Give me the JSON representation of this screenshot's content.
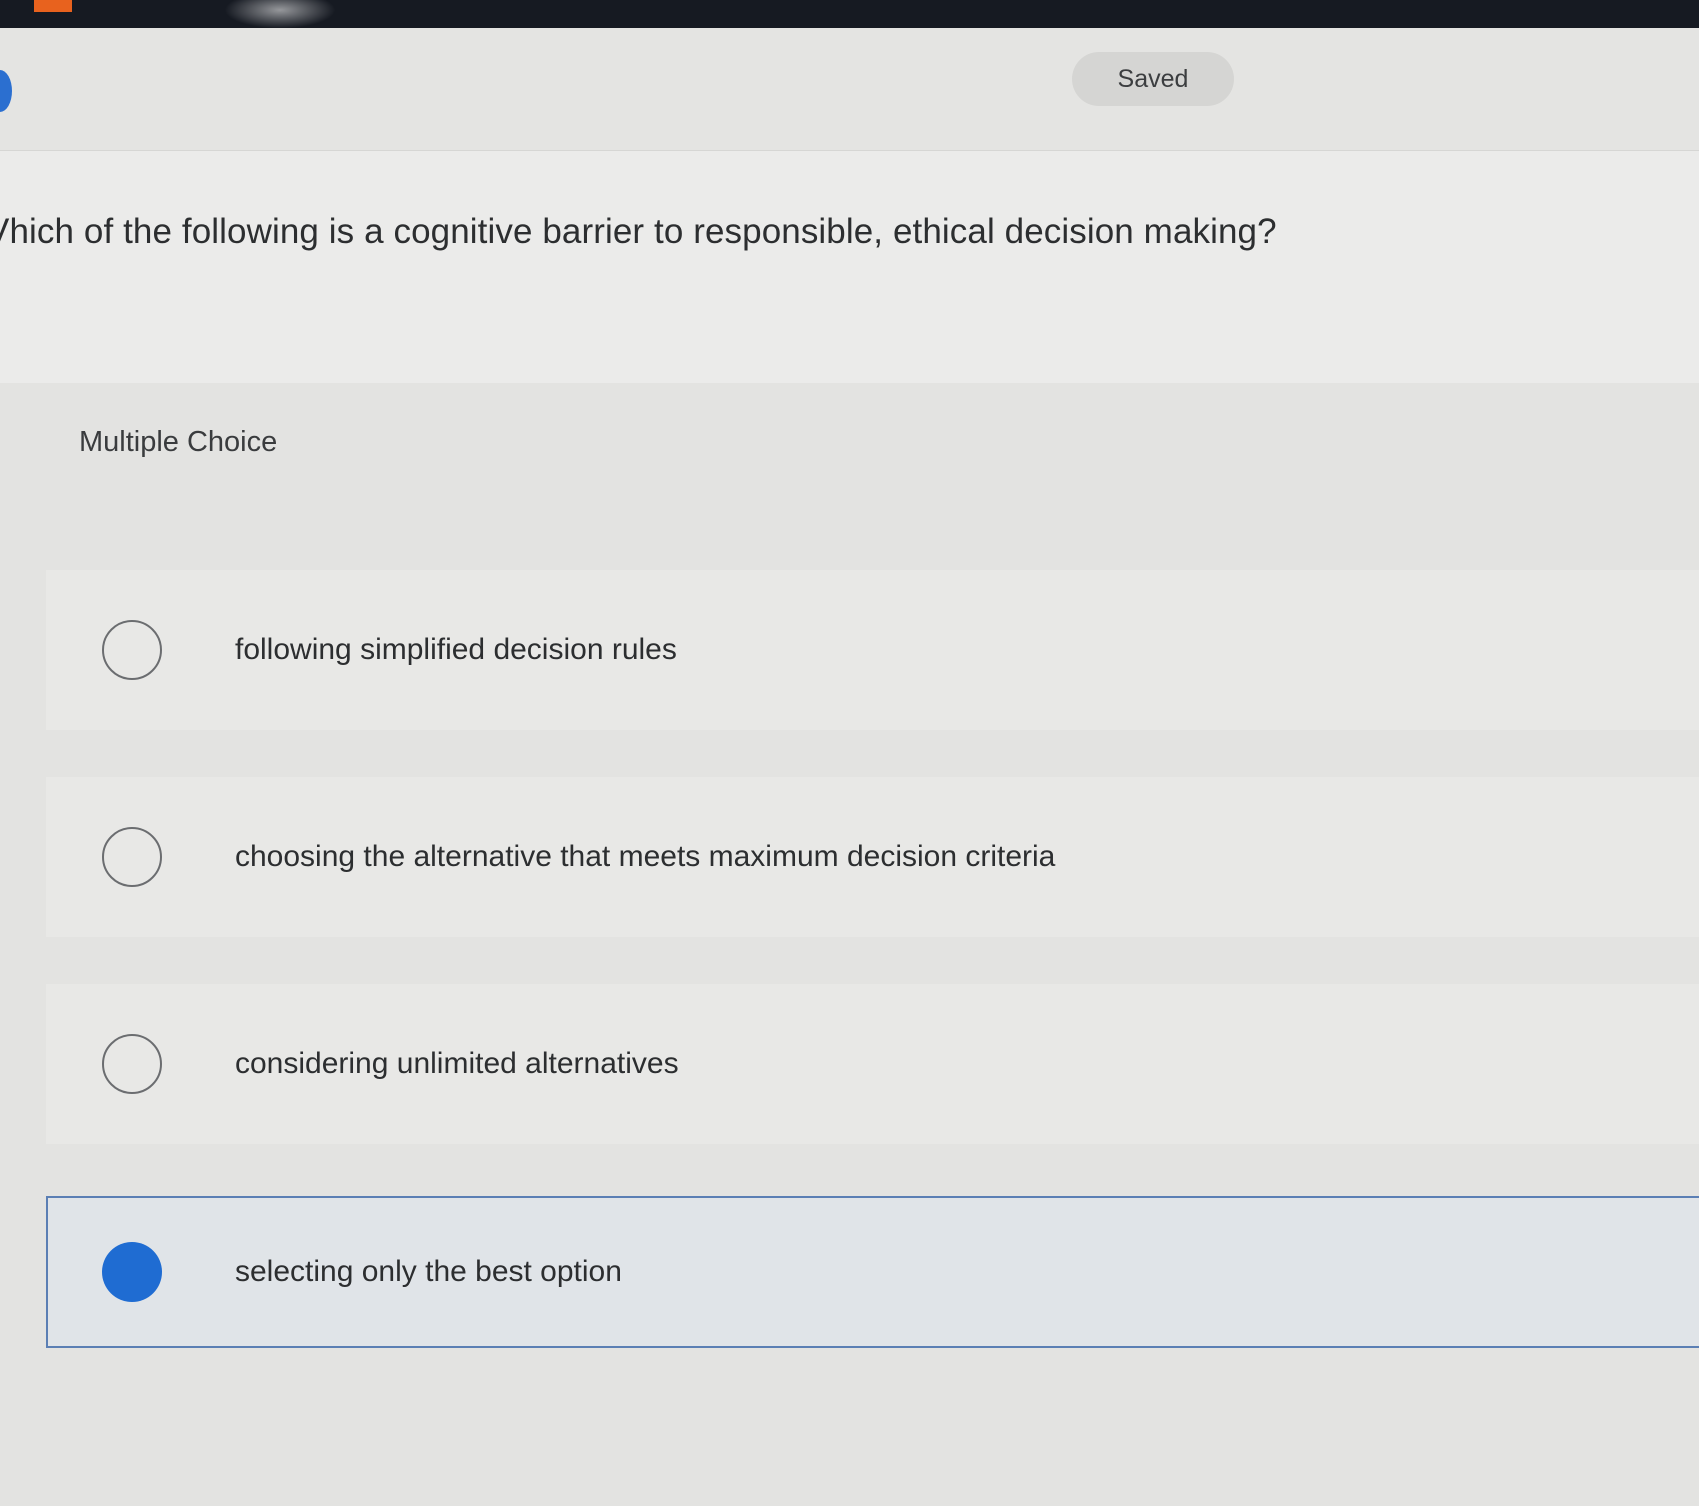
{
  "header": {
    "status_label": "Saved"
  },
  "question": {
    "text": "Vhich of the following is a cognitive barrier to responsible, ethical decision making?",
    "type_label": "Multiple Choice"
  },
  "options": [
    {
      "label": "following simplified decision rules",
      "selected": false
    },
    {
      "label": "choosing the alternative that meets maximum decision criteria",
      "selected": false
    },
    {
      "label": "considering unlimited alternatives",
      "selected": false
    },
    {
      "label": "selecting only the best option",
      "selected": true
    }
  ],
  "colors": {
    "accent": "#1f6cd2",
    "selected_border": "#5b7fb4",
    "background": "#e6e6e4"
  }
}
